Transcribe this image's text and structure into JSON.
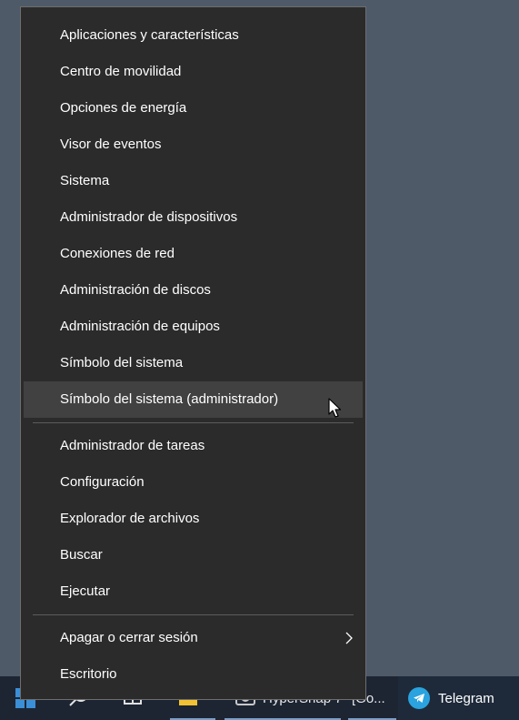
{
  "menu": {
    "groups": [
      {
        "items": [
          {
            "label": "Aplicaciones y características"
          },
          {
            "label": "Centro de movilidad"
          },
          {
            "label": "Opciones de energía"
          },
          {
            "label": "Visor de eventos"
          },
          {
            "label": "Sistema"
          },
          {
            "label": "Administrador de dispositivos"
          },
          {
            "label": "Conexiones de red"
          },
          {
            "label": "Administración de discos"
          },
          {
            "label": "Administración de equipos"
          },
          {
            "label": "Símbolo del sistema"
          },
          {
            "label": "Símbolo del sistema (administrador)",
            "hovered": true
          }
        ]
      },
      {
        "items": [
          {
            "label": "Administrador de tareas"
          },
          {
            "label": "Configuración"
          },
          {
            "label": "Explorador de archivos"
          },
          {
            "label": "Buscar"
          },
          {
            "label": "Ejecutar"
          }
        ]
      },
      {
        "items": [
          {
            "label": "Apagar o cerrar sesión",
            "submenu": true
          },
          {
            "label": "Escritorio"
          }
        ]
      }
    ]
  },
  "taskbar": {
    "start_icon": "windows-logo-icon",
    "items": [
      {
        "icon": "search-icon"
      },
      {
        "icon": "task-view-icon"
      },
      {
        "icon": "file-explorer-icon"
      },
      {
        "icon": "hypersnap-icon",
        "label": "HyperSnap 7"
      },
      {
        "label": "[Go..."
      }
    ],
    "telegram": {
      "label": "Telegram",
      "icon": "telegram-icon"
    }
  },
  "colors": {
    "menu_bg": "#2b2b2b",
    "menu_hover": "#414141",
    "desktop": "#4e5a68",
    "taskbar": "#1d2533",
    "accent_start": "#3b8fd6",
    "telegram": "#2aa3df"
  }
}
